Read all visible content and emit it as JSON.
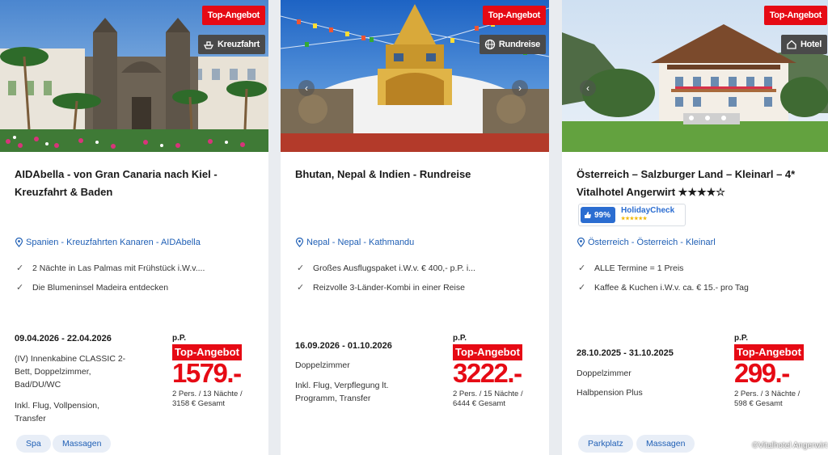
{
  "cards": [
    {
      "badge_top": "Top-Angebot",
      "category": "Kreuzfahrt",
      "category_icon": "ship-icon",
      "title": "AIDAbella - von Gran Canaria nach Kiel - Kreuzfahrt & Baden",
      "location": "Spanien - Kreuzfahrten Kanaren - AIDAbella",
      "features": [
        "2 Nächte in Las Palmas mit Frühstück i.W.v....",
        "Die Blumeninsel Madeira entdecken"
      ],
      "dates": "09.04.2026 - 22.04.2026",
      "room": "(IV) Innenkabine CLASSIC 2-Bett, Doppelzimmer, Bad/DU/WC",
      "included": "Inkl. Flug, Vollpension, Transfer",
      "per_person": "p.P.",
      "price_badge": "Top-Angebot",
      "price": "1579.-",
      "price_info_line1": "2 Pers. / 13 Nächte /",
      "price_info_line2": "3158 € Gesamt",
      "tags": [
        "Spa",
        "Massagen"
      ]
    },
    {
      "badge_top": "Top-Angebot",
      "category": "Rundreise",
      "category_icon": "globe-icon",
      "title": "Bhutan, Nepal & Indien - Rundreise",
      "location": "Nepal - Nepal - Kathmandu",
      "features": [
        "Großes Ausflugspaket i.W.v. € 400,- p.P. i...",
        "Reizvolle 3-Länder-Kombi in einer Reise"
      ],
      "dates": "16.09.2026 - 01.10.2026",
      "room": "Doppelzimmer",
      "included": "Inkl. Flug, Verpflegung lt. Programm, Transfer",
      "per_person": "p.P.",
      "price_badge": "Top-Angebot",
      "price": "3222.-",
      "price_info_line1": "2 Pers. / 15 Nächte /",
      "price_info_line2": "6444 € Gesamt",
      "tags": []
    },
    {
      "badge_top": "Top-Angebot",
      "category": "Hotel",
      "category_icon": "house-icon",
      "title": "Österreich – Salzburger Land – Kleinarl – 4* Vitalhotel Angerwirt ★★★★☆",
      "copyright": "©Vitalhotel Angerwirt",
      "holidaycheck_score": "99%",
      "holidaycheck_name": "HolidayCheck",
      "holidaycheck_stars": "★★★★★★",
      "location": "Österreich - Österreich - Kleinarl",
      "features": [
        "ALLE Termine = 1 Preis",
        "Kaffee & Kuchen i.W.v. ca. € 15.- pro Tag"
      ],
      "dates": "28.10.2025 - 31.10.2025",
      "room": "Doppelzimmer",
      "included": "Halbpension Plus",
      "per_person": "p.P.",
      "price_badge": "Top-Angebot",
      "price": "299.-",
      "price_info_line1": "2 Pers. / 3 Nächte /",
      "price_info_line2": "598 € Gesamt",
      "tags": [
        "Parkplatz",
        "Massagen"
      ]
    }
  ],
  "colors": {
    "accent_red": "#e60a14",
    "link_blue": "#1f5fb5",
    "tag_bg": "#e8eef7"
  },
  "nav": {
    "prev": "‹",
    "next": "›"
  }
}
